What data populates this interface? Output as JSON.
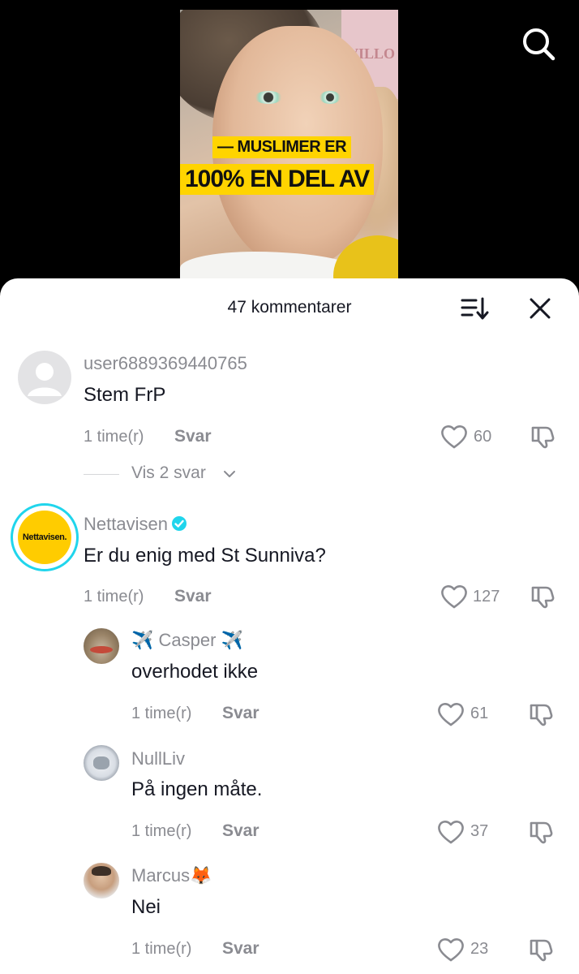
{
  "video": {
    "caption_line1": "— MUSLIMER ER",
    "caption_line2": "100% EN DEL AV",
    "sign_text": "VILLO"
  },
  "sheet": {
    "title": "47 kommentarer"
  },
  "colors": {
    "caption_bg": "#ffd400",
    "verified": "#20d5ec",
    "muted_text": "#8a8b91"
  },
  "comments": [
    {
      "username": "user6889369440765",
      "text": "Stem FrP",
      "time": "1 time(r)",
      "reply_label": "Svar",
      "likes": "60",
      "view_replies": "Vis 2 svar",
      "avatar_icon": "default-avatar-icon"
    },
    {
      "username": "Nettavisen",
      "verified": true,
      "text": "Er du enig med St Sunniva?",
      "time": "1 time(r)",
      "reply_label": "Svar",
      "likes": "127",
      "avatar_text": "Nettavisen.",
      "replies": [
        {
          "username": "✈️ Casper ✈️",
          "text": "overhodet ikke",
          "time": "1 time(r)",
          "reply_label": "Svar",
          "likes": "61"
        },
        {
          "username": "NullLiv",
          "text": "På ingen måte.",
          "time": "1 time(r)",
          "reply_label": "Svar",
          "likes": "37"
        },
        {
          "username": "Marcus🦊",
          "text": "Nei",
          "time": "1 time(r)",
          "reply_label": "Svar",
          "likes": "23"
        }
      ]
    }
  ]
}
